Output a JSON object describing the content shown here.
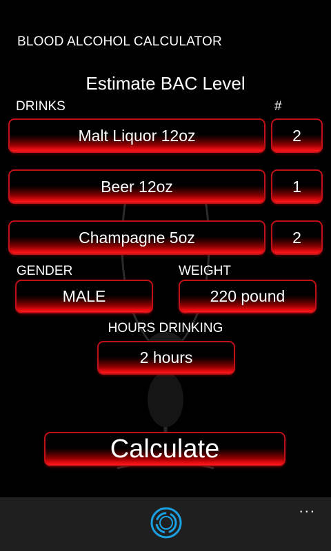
{
  "app_title": "BLOOD ALCOHOL CALCULATOR",
  "page_title": "Estimate BAC Level",
  "labels": {
    "drinks": "DRINKS",
    "count": "#",
    "gender": "GENDER",
    "weight": "WEIGHT",
    "hours": "HOURS DRINKING"
  },
  "drinks": [
    {
      "name": "Malt Liquor 12oz",
      "count": "2"
    },
    {
      "name": "Beer 12oz",
      "count": "1"
    },
    {
      "name": "Champagne 5oz",
      "count": "2"
    }
  ],
  "gender": "MALE",
  "weight": "220 pound",
  "hours": "2 hours",
  "calculate_label": "Calculate",
  "app_bar": {
    "more_label": "...",
    "icon": "refresh-icon"
  },
  "colors": {
    "accent": "#e00a10",
    "app_bar": "#1f1f1f",
    "icon_accent": "#1ba1e2"
  }
}
